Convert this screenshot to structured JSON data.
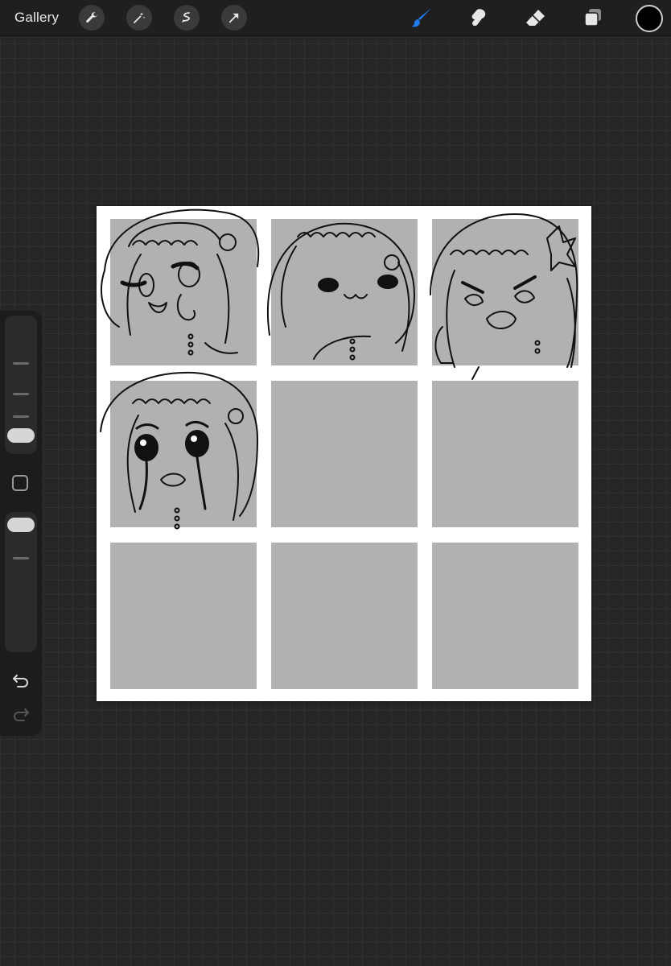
{
  "topbar": {
    "gallery_label": "Gallery",
    "left_tools": [
      "wrench-icon",
      "magic-wand-icon",
      "selection-icon",
      "transform-arrow-icon"
    ],
    "right_tools": [
      "brush-icon",
      "smudge-icon",
      "eraser-icon",
      "layers-icon"
    ],
    "active_tool": "brush-icon",
    "accent_color": "#1f7cf2",
    "current_color": "#000000"
  },
  "sidebar": {
    "brush_size_slider": 0.25,
    "opacity_slider": 0.0,
    "modify_button": "square-icon",
    "undo": "undo-arrow-icon",
    "redo": "redo-arrow-icon"
  },
  "canvas": {
    "grid_rows": 3,
    "grid_cols": 3,
    "cell_color": "#b1b1b1",
    "background_color": "#ffffff",
    "cells_with_drawings": [
      0,
      1,
      2,
      3
    ]
  }
}
